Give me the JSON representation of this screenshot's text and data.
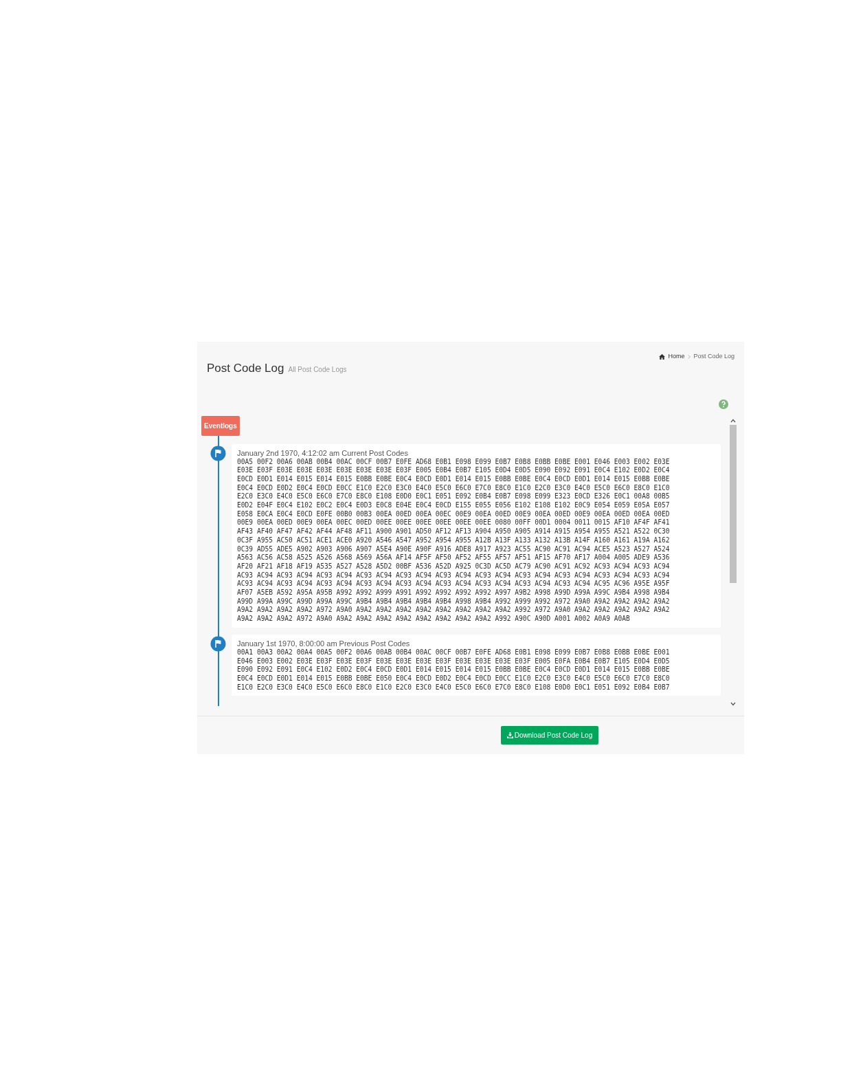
{
  "header": {
    "title": "Post Code Log",
    "subtitle": "All Post Code Logs"
  },
  "breadcrumb": [
    {
      "label": "Home",
      "kind": "home"
    },
    {
      "label": "Post Code Log",
      "kind": "current"
    }
  ],
  "timeline": {
    "label": "Eventlogs",
    "entries": [
      {
        "heading": "January 2nd 1970, 4:12:02 am Current Post Codes",
        "lines": [
          "00A5 00F2 00A6 00AB 00B4 00AC 00CF 00B7 E0FE AD68 E0B1 E098 E099 E0B7 E0B8 E0BB E0BE E001 E046 E003 E002 E03E",
          "E03E E03F E03E E03E E03E E03E E03E E03E E03F E005 E0B4 E0B7 E105 E0D4 E0D5 E090 E092 E091 E0C4 E102 E0D2 E0C4",
          "E0CD E0D1 E014 E015 E014 E015 E0BB E0BE E0C4 E0CD E0D1 E014 E015 E0BB E0BE E0C4 E0CD E0D1 E014 E015 E0BB E0BE",
          "E0C4 E0CD E0D2 E0C4 E0CD E0CC E1C0 E2C0 E3C0 E4C0 E5C0 E6C0 E7C0 E8C0 E1C0 E2C0 E3C0 E4C0 E5C0 E6C0 E8C0 E1C0",
          "E2C0 E3C0 E4C0 E5C0 E6C0 E7C0 E8C0 E108 E0D0 E0C1 E051 E092 E0B4 E0B7 E098 E099 E323 E0CD E326 E0C1 00A8 00B5",
          "E0D2 E04F E0C4 E102 E0C2 E0C4 E0D3 E0C8 E04E E0C4 E0CD E155 E055 E056 E102 E108 E102 E0C9 E054 E059 E05A E057",
          "E058 E0CA E0C4 E0CD E0FE 00B0 00B3 00EA 00ED 00EA 00EC 00E9 00EA 00ED 00E9 00EA 00ED 00E9 00EA 00ED 00EA 00ED",
          "00E9 00EA 00ED 00E9 00EA 00EC 00ED 00EE 00EE 00EE 00EE 00EE 00EE 0080 00FF 00D1 0004 0011 0015 AF10 AF4F AF41",
          "AF43 AF40 AF47 AF42 AF44 AF48 AF11 A900 A901 AD50 AF12 AF13 A904 A950 A905 A914 A915 A954 A955 A521 A522 0C30",
          "0C3F A955 AC50 AC51 ACE1 ACE0 A920 A546 A547 A952 A954 A955 A12B A13F A133 A132 A13B A14F A160 A161 A19A A162",
          "0C39 AD55 ADE5 A902 A903 A906 A907 A5E4 A90E A90F A916 ADE8 A917 A923 AC55 AC90 AC91 AC94 ACE5 A523 A527 A524",
          "A563 AC56 AC58 A525 A526 A568 A569 A56A AF14 AF5F AF50 AF52 AF55 AF57 AF51 AF15 AF70 AF17 A004 A005 ADE9 A536",
          "AF20 AF21 AF18 AF19 A535 A527 A528 A5D2 00BF A536 A52D A925 0C3D AC5D AC79 AC90 AC91 AC92 AC93 AC94 AC93 AC94",
          "AC93 AC94 AC93 AC94 AC93 AC94 AC93 AC94 AC93 AC94 AC93 AC94 AC93 AC94 AC93 AC94 AC93 AC94 AC93 AC94 AC93 AC94",
          "AC93 AC94 AC93 AC94 AC93 AC94 AC93 AC94 AC93 AC94 AC93 AC94 AC93 AC94 AC93 AC94 AC93 AC94 AC95 AC96 A95E A95F",
          "AF07 A5EB A592 A95A A95B A992 A992 A999 A991 A992 A992 A992 A992 A997 A9B2 A998 A99D A99A A99C A9B4 A998 A9B4",
          "A99D A99A A99C A99D A99A A99C A9B4 A9B4 A9B4 A9B4 A9B4 A998 A9B4 A992 A999 A992 A972 A9A0 A9A2 A9A2 A9A2 A9A2",
          "A9A2 A9A2 A9A2 A9A2 A972 A9A0 A9A2 A9A2 A9A2 A9A2 A9A2 A9A2 A9A2 A9A2 A992 A972 A9A0 A9A2 A9A2 A9A2 A9A2 A9A2",
          "A9A2 A9A2 A9A2 A972 A9A0 A9A2 A9A2 A9A2 A9A2 A9A2 A9A2 A9A2 A9A2 A992 A90C A90D A001 A002 A0A9 A0AB"
        ]
      },
      {
        "heading": "January 1st 1970, 8:00:00 am Previous Post Codes",
        "lines": [
          "00A1 00A3 00A2 00A4 00A5 00F2 00A6 00AB 00B4 00AC 00CF 00B7 E0FE AD68 E0B1 E098 E099 E0B7 E0B8 E0BB E0BE E001",
          "E046 E003 E002 E03E E03F E03E E03F E03E E03E E03E E03F E03E E03E E03E E03F E005 E0FA E0B4 E0B7 E105 E0D4 E0D5",
          "E090 E092 E091 E0C4 E102 E0D2 E0C4 E0CD E0D1 E014 E015 E014 E015 E0BB E0BE E0C4 E0CD E0D1 E014 E015 E0BB E0BE",
          "E0C4 E0CD E0D1 E014 E015 E0BB E0BE E050 E0C4 E0CD E0D2 E0C4 E0CD E0CC E1C0 E2C0 E3C0 E4C0 E5C0 E6C0 E7C0 E8C0",
          "E1C0 E2C0 E3C0 E4C0 E5C0 E6C0 E8C0 E1C0 E2C0 E3C0 E4C0 E5C0 E6C0 E7C0 E8C0 E108 E0D0 E0C1 E051 E092 E0B4 E0B7"
        ]
      }
    ]
  },
  "download_button": "Download Post Code Log"
}
